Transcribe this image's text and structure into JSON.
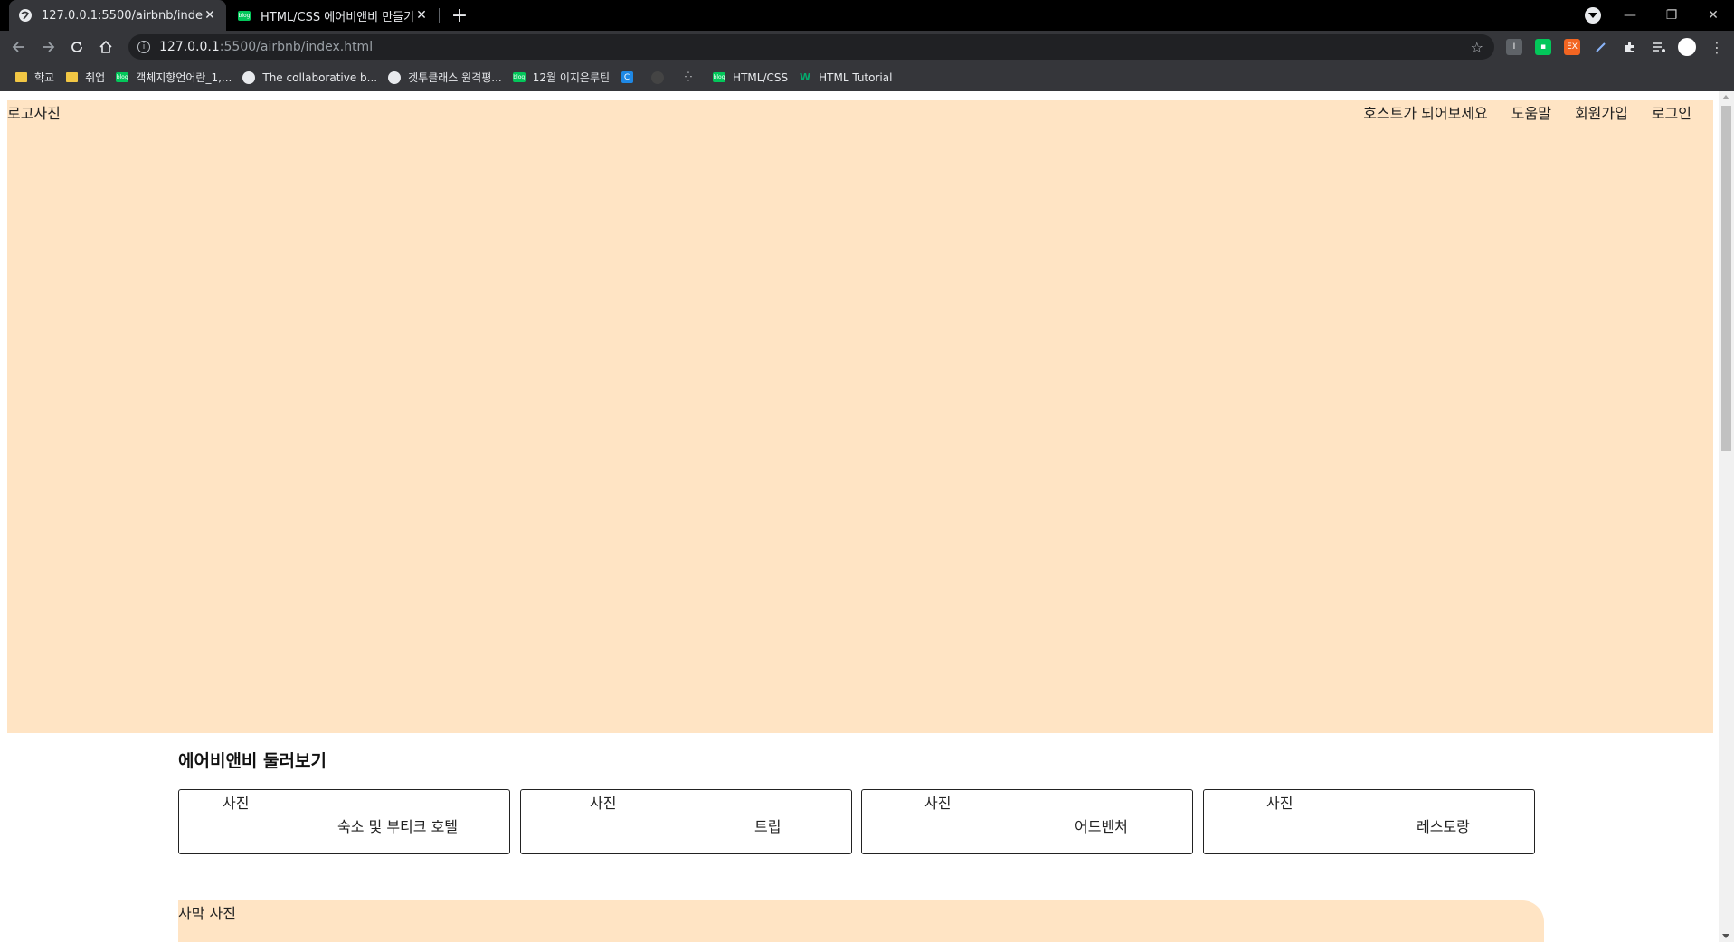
{
  "browser": {
    "tabs": [
      {
        "title": "127.0.0.1:5500/airbnb/index.html",
        "active": true
      },
      {
        "title": "HTML/CSS 에어비앤비 만들기 -",
        "active": false
      }
    ],
    "address": {
      "host": "127.0.0.1",
      "rest": ":5500/airbnb/index.html"
    },
    "bookmarks": [
      {
        "label": "학교",
        "icon": "folder-icon"
      },
      {
        "label": "취업",
        "icon": "folder-icon"
      },
      {
        "label": "객체지향언어란_1,...",
        "icon": "naver-blog-icon"
      },
      {
        "label": "The collaborative b...",
        "icon": "github-icon"
      },
      {
        "label": "겟투클래스 원격평...",
        "icon": "globe-icon"
      },
      {
        "label": "12월 이지은루틴",
        "icon": "naver-blog-icon"
      },
      {
        "label": "",
        "icon": "c-icon"
      },
      {
        "label": "",
        "icon": "github-icon"
      },
      {
        "label": "",
        "icon": "dots-icon"
      },
      {
        "label": "HTML/CSS",
        "icon": "naver-blog-icon"
      },
      {
        "label": "HTML Tutorial",
        "icon": "w3-icon"
      }
    ],
    "colors": {
      "tabstrip": "#000000",
      "toolbar": "#35363a",
      "omnibox": "#202124"
    }
  },
  "page": {
    "header": {
      "logo": "로고사진",
      "nav": [
        "호스트가 되어보세요",
        "도움말",
        "회원가입",
        "로그인"
      ]
    },
    "explore": {
      "title": "에어비앤비 둘러보기",
      "cards": [
        {
          "photo": "사진",
          "label": "숙소 및 부티크 호텔"
        },
        {
          "photo": "사진",
          "label": "트립"
        },
        {
          "photo": "사진",
          "label": "어드벤처"
        },
        {
          "photo": "사진",
          "label": "레스토랑"
        }
      ]
    },
    "desert": {
      "label": "사막 사진"
    },
    "colors": {
      "hero": "#ffe4c4"
    }
  }
}
